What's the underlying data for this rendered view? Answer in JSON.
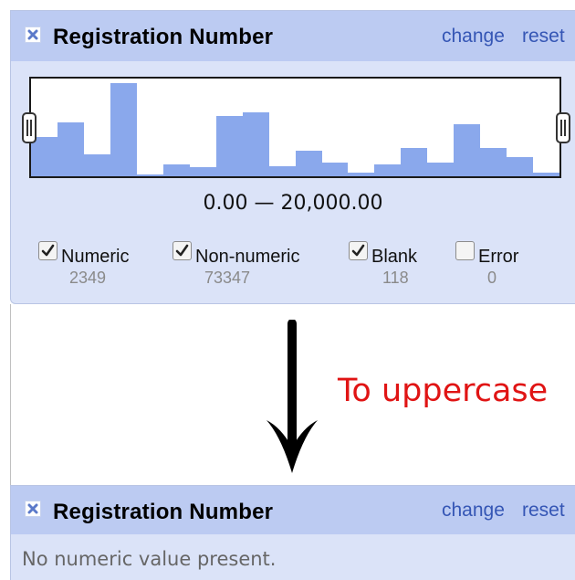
{
  "before_facet": {
    "title": "Registration Number",
    "close_icon": "close-icon",
    "links": {
      "change": "change",
      "reset": "reset"
    },
    "histogram": {
      "bar_color": "#8aa8ec",
      "relative_heights": [
        0.4,
        0.55,
        0.22,
        0.95,
        0.02,
        0.12,
        0.09,
        0.62,
        0.65,
        0.1,
        0.26,
        0.14,
        0.04,
        0.12,
        0.29,
        0.14,
        0.53,
        0.29,
        0.2,
        0.04
      ]
    },
    "range": "0.00 — 20,000.00",
    "choices": [
      {
        "label": "Numeric",
        "count": "2349",
        "checked": true
      },
      {
        "label": "Non-numeric",
        "count": "73347",
        "checked": true
      },
      {
        "label": "Blank",
        "count": "118",
        "checked": true
      },
      {
        "label": "Error",
        "count": "0",
        "checked": false
      }
    ]
  },
  "annotation": {
    "text": "To uppercase",
    "color": "#e01414"
  },
  "after_facet": {
    "title": "Registration Number",
    "close_icon": "close-icon",
    "links": {
      "change": "change",
      "reset": "reset"
    },
    "message": "No numeric value present."
  }
}
